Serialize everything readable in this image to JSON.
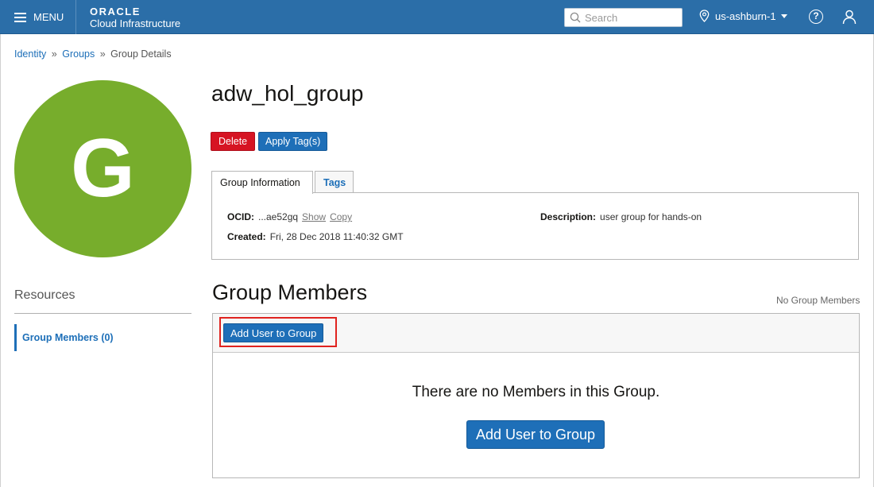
{
  "header": {
    "menu_label": "MENU",
    "brand_line1": "ORACLE",
    "brand_line2": "Cloud Infrastructure",
    "search_placeholder": "Search",
    "region": "us-ashburn-1"
  },
  "breadcrumb": {
    "items": [
      "Identity",
      "Groups",
      "Group Details"
    ],
    "separator": "»"
  },
  "avatar": {
    "letter": "G",
    "color": "#77ad2c"
  },
  "group": {
    "name": "adw_hol_group",
    "delete_label": "Delete",
    "apply_tags_label": "Apply Tag(s)"
  },
  "tabs": [
    "Group Information",
    "Tags"
  ],
  "info": {
    "ocid_label": "OCID:",
    "ocid_value": "...ae52gq",
    "show_label": "Show",
    "copy_label": "Copy",
    "created_label": "Created:",
    "created_value": "Fri, 28 Dec 2018 11:40:32 GMT",
    "description_label": "Description:",
    "description_value": "user group for hands-on"
  },
  "resources": {
    "title": "Resources",
    "items": [
      "Group Members (0)"
    ]
  },
  "members": {
    "title": "Group Members",
    "count_text": "No Group Members",
    "add_button_small": "Add User to Group",
    "empty_message": "There are no Members in this Group.",
    "add_button_large": "Add User to Group"
  },
  "colors": {
    "header_bg": "#2b6ea8",
    "primary": "#1e6fb8",
    "danger": "#d61423",
    "highlight": "#e0231f"
  }
}
